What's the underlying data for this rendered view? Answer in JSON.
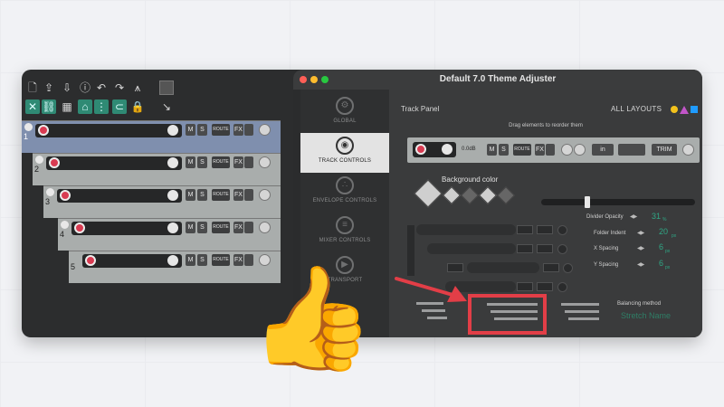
{
  "adjuster": {
    "title": "Default 7.0 Theme Adjuster",
    "sidebar": [
      {
        "label": "GLOBAL",
        "icon": "gear-icon"
      },
      {
        "label": "TRACK CONTROLS",
        "icon": "target-icon"
      },
      {
        "label": "ENVELOPE CONTROLS",
        "icon": "envelope-nodes-icon"
      },
      {
        "label": "MIXER CONTROLS",
        "icon": "fader-icon"
      },
      {
        "label": "TRANSPORT",
        "icon": "play-icon"
      }
    ],
    "panel_name": "Track Panel",
    "all_layouts": "ALL LAYOUTS",
    "layout_colors": [
      "#f2c21c",
      "#c255c8",
      "#1f9bff"
    ],
    "drag_hint": "Drag elements to reorder them",
    "preview": {
      "volume": "0.0dB",
      "in_label": "in",
      "trim_label": "TRIM"
    },
    "background_color_label": "Background color",
    "divider_opacity": {
      "label": "Divider Opacity",
      "value": "31",
      "unit": "%"
    },
    "folder_indent": {
      "label": "Folder Indent",
      "value": "20",
      "unit": "px"
    },
    "x_spacing": {
      "label": "X Spacing",
      "value": "6",
      "unit": "px"
    },
    "y_spacing": {
      "label": "Y Spacing",
      "value": "6",
      "unit": "px"
    },
    "balancing": {
      "label": "Balancing method",
      "value": "Stretch Name"
    }
  },
  "tracks": [
    {
      "number": "1"
    },
    {
      "number": "2"
    },
    {
      "number": "3"
    },
    {
      "number": "4"
    },
    {
      "number": "5"
    }
  ],
  "track_buttons": {
    "mute": "M",
    "solo": "S",
    "route": "ROUTE",
    "fx": "FX"
  }
}
